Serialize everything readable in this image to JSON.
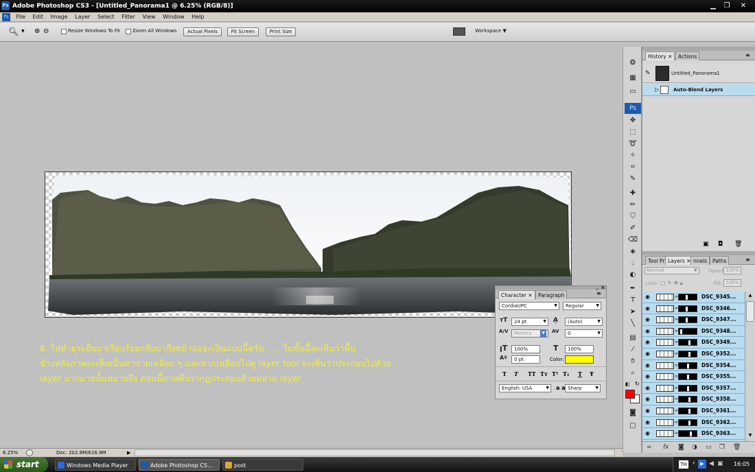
{
  "window": {
    "title": "Adobe Photoshop CS3 - [Untitled_Panorama1 @ 6.25% (RGB/8)]",
    "ps_badge": "Ps"
  },
  "menu": [
    "File",
    "Edit",
    "Image",
    "Layer",
    "Select",
    "Filter",
    "View",
    "Window",
    "Help"
  ],
  "options": {
    "resize_windows": "Resize Windows To Fit",
    "zoom_all": "Zoom All Windows",
    "actual_pixels": "Actual Pixels",
    "fit_screen": "Fit Screen",
    "print_size": "Print Size",
    "workspace": "Workspace ▼"
  },
  "caption_lines": [
    "8. ไปทำธุระอื่นมาเรียบร้อยกลับมาถึงหน้าจอจะเป็นแบบนี้ครับ . . . ในขั้นนี้จะเห็นว่าพื้น",
    "ข้างหลังภาพจะเห็นเป็นตาข่ายเหลี่ยม ๆ และหากเหลือบไปดู layer tool จะเห็นว่าประกอบไปด้วย",
    "layer มากมายนั้นหมายถึง ตอนนี้ภาพที่ปรากฏประกอบด้วยหลาย  layer"
  ],
  "history": {
    "tabs": [
      "History",
      "Actions"
    ],
    "snapshot": "Untitled_Panorama1",
    "step": "Auto-Blend Layers"
  },
  "toolbox_badge": "Ps",
  "layers": {
    "tabs": [
      "Tool Pr",
      "Layers",
      "nnels",
      "Paths"
    ],
    "blend_mode": "Normal",
    "opacity_label": "Opacity:",
    "opacity_value": "100%",
    "lock_label": "Lock:",
    "fill_label": "Fill:",
    "fill_value": "100%",
    "items": [
      "DSC_9345...",
      "DSC_9346...",
      "DSC_9347...",
      "DSC_9348...",
      "DSC_9349...",
      "DSC_9352...",
      "DSC_9354...",
      "DSC_9355...",
      "DSC_9357...",
      "DSC_9358...",
      "DSC_9361...",
      "DSC_9362...",
      "DSC_9363..."
    ]
  },
  "character": {
    "tabs": [
      "Character",
      "Paragraph"
    ],
    "font": "CordiaUPC",
    "style": "Regular",
    "size": "24 pt",
    "leading": "(Auto)",
    "kerning": "Metrics",
    "tracking": "0",
    "vscale": "100%",
    "hscale": "100%",
    "baseline": "0 pt",
    "color_label": "Color:",
    "color_value": "#ffff00",
    "language": "English: USA",
    "aa_prefix": "a a",
    "antialias": "Sharp",
    "style_buttons": [
      "T",
      "T",
      "TT",
      "Tт",
      "T¹",
      "T₁",
      "T",
      "Ŧ"
    ]
  },
  "status": {
    "zoom": "6.25%",
    "doc": "Doc: 202.8M/616.9M"
  },
  "taskbar": {
    "start": "start",
    "tasks": [
      "Windows Media Player",
      "Adobe Photoshop CS...",
      "post"
    ],
    "lang": "TH",
    "clock": "16:05"
  }
}
